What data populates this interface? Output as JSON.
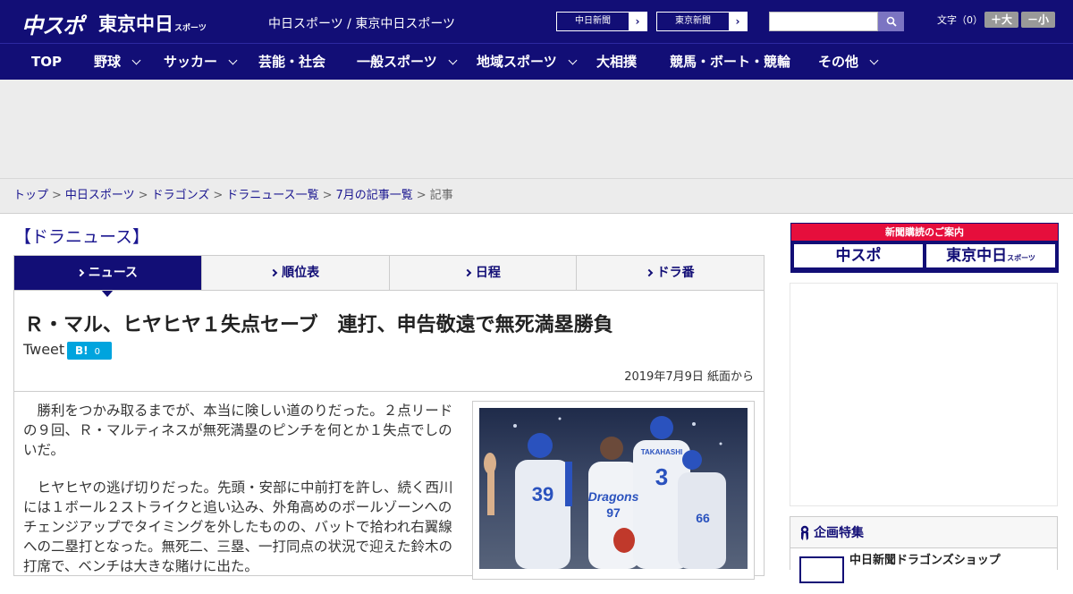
{
  "header": {
    "logo_main": "中スポ",
    "logo_tokyo": "東京中日",
    "logo_tokyo_small": "スポーツ",
    "tagline": "中日スポーツ / 東京中日スポーツ",
    "newspaper_buttons": [
      {
        "label": "中日新聞",
        "arrow": "›"
      },
      {
        "label": "東京新聞",
        "arrow": "›"
      }
    ],
    "search": {
      "placeholder": "",
      "value": "",
      "icon": "search-icon"
    },
    "font_size_label": "文字（0）",
    "font_bigger": "＋大",
    "font_smaller": "－小"
  },
  "nav": {
    "items": [
      {
        "label": "TOP"
      },
      {
        "label": "野球"
      },
      {
        "label": "サッカー"
      },
      {
        "label": "芸能・社会"
      },
      {
        "label": "一般スポーツ"
      },
      {
        "label": "地域スポーツ"
      },
      {
        "label": "大相撲"
      },
      {
        "label": "競馬・ボート・競輪"
      },
      {
        "label": "その他"
      }
    ]
  },
  "breadcrumb": {
    "items": [
      "トップ",
      "中日スポーツ",
      "ドラゴンズ",
      "ドラニュース一覧",
      "7月の記事一覧"
    ],
    "current": "記事",
    "separator": ">"
  },
  "main": {
    "section_title": "【ドラニュース】",
    "tabs": [
      {
        "label": "ニュース",
        "active": true
      },
      {
        "label": "順位表",
        "active": false
      },
      {
        "label": "日程",
        "active": false
      },
      {
        "label": "ドラ番",
        "active": false
      }
    ],
    "headline": "Ｒ・マル、ヒヤヒヤ１失点セーブ　連打、申告敬遠で無死満塁勝負",
    "tweet_label": "Tweet",
    "hatena_label": "B!",
    "hatena_count": "0",
    "date": "2019年7月9日 紙面から",
    "paragraphs": [
      "勝利をつかみ取るまでが、本当に険しい道のりだった。２点リードの９回、Ｒ・マルティネスが無死満塁のピンチを何とか１失点でしのいだ。",
      "ヒヤヒヤの逃げ切りだった。先頭・安部に中前打を許し、続く西川には１ボール２ストライクと追い込み、外角高めのボールゾーンへのチェンジアップでタイミングを外したものの、バットで拾われ右翼線への二塁打となった。無死二、三塁、一打同点の状況で迎えた鈴木の打席で、ベンチは大きな賭けに出た。"
    ],
    "photo_numbers": [
      "39",
      "3",
      "97",
      "66"
    ],
    "photo_names": [
      "TAKAHASHI",
      "Dragons"
    ]
  },
  "sidebar": {
    "subscribe_title": "新聞購読のご案内",
    "subscribe_logos": [
      "中スポ",
      "東京中日"
    ],
    "subscribe_small": "スポーツ",
    "special_title": "企画特集",
    "special_item": "中日新聞ドラゴンズショップ"
  },
  "colors": {
    "brand_navy": "#120e76",
    "subscribe_red": "#e60e3c",
    "hatena_blue": "#00a4de"
  }
}
